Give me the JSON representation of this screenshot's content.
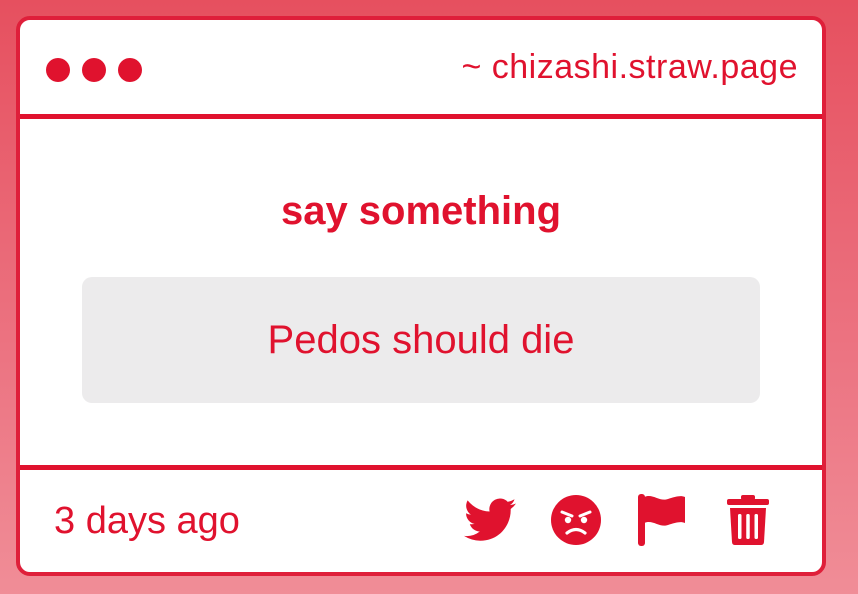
{
  "window": {
    "url": "~ chizashi.straw.page"
  },
  "main": {
    "prompt": "say something",
    "message": "Pedos should die"
  },
  "footer": {
    "timestamp": "3 days ago",
    "actions": [
      {
        "icon": "twitter-icon"
      },
      {
        "icon": "angry-face-icon"
      },
      {
        "icon": "flag-icon"
      },
      {
        "icon": "trash-icon"
      }
    ]
  },
  "colors": {
    "accent": "#e0122e",
    "card_background": "#ffffff",
    "message_background": "#ecebec",
    "page_background_top": "#e6505f",
    "page_background_bottom": "#f08d97"
  }
}
